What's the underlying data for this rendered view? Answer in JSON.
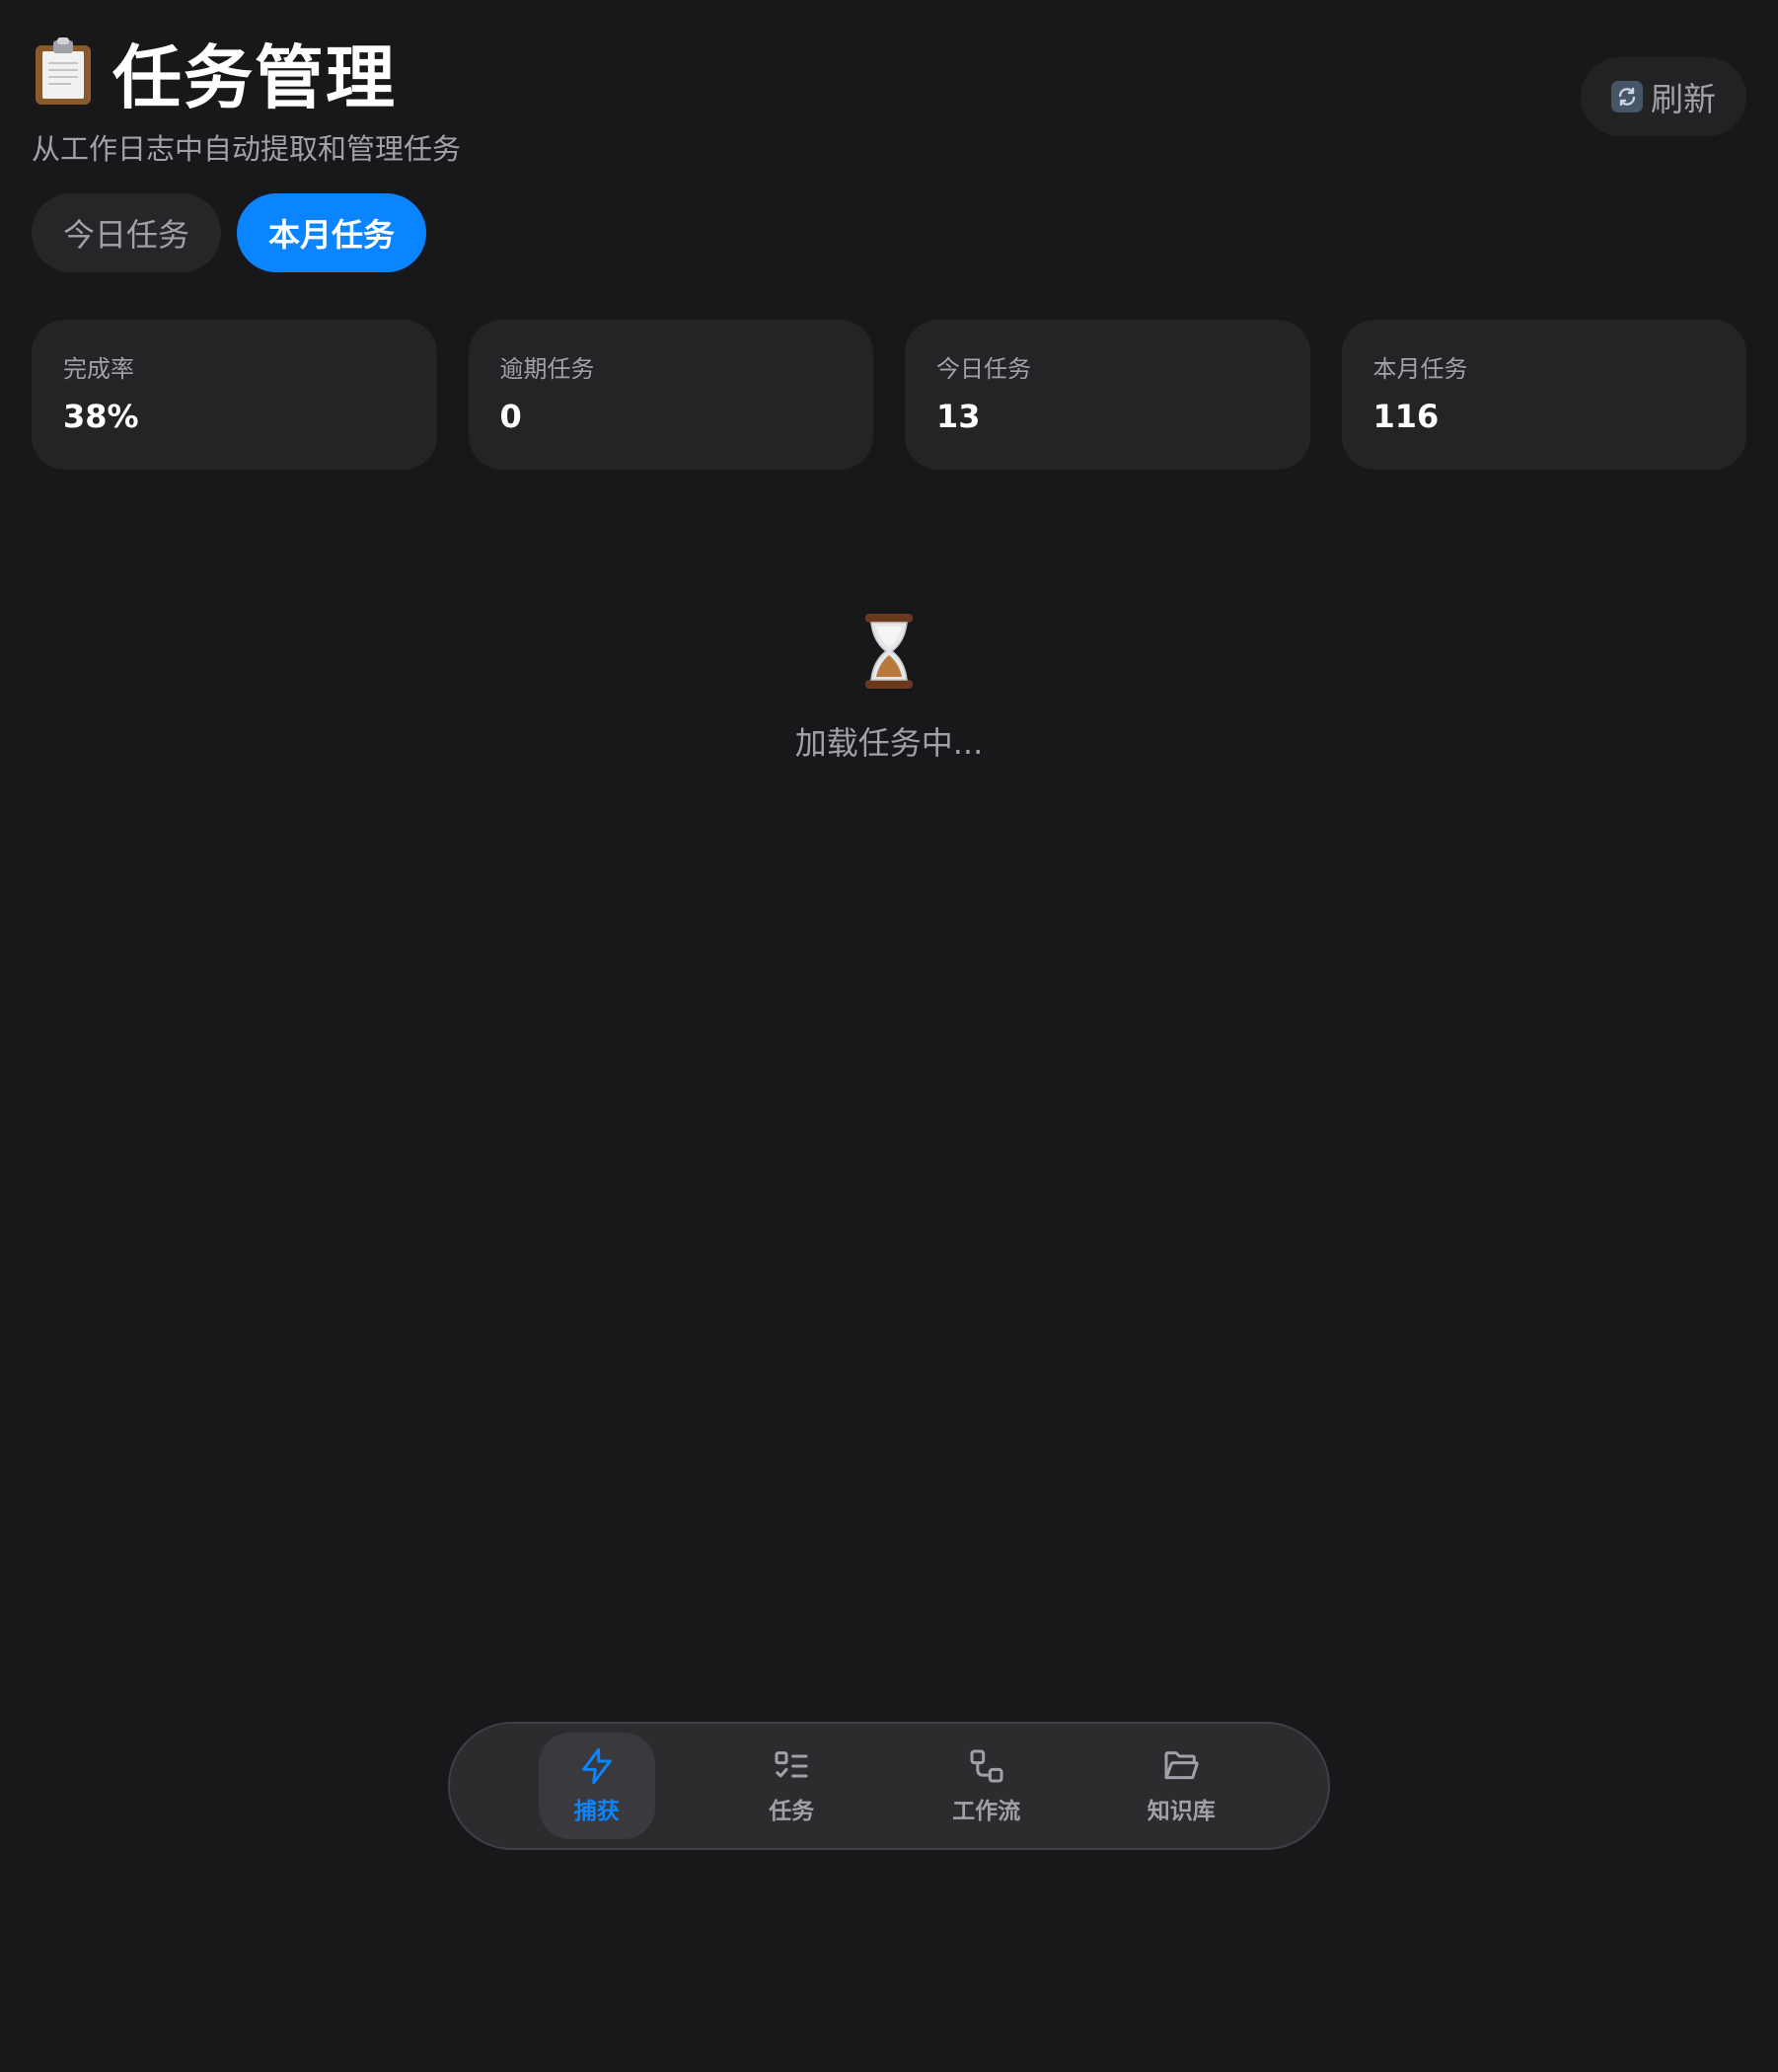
{
  "header": {
    "title": "任务管理",
    "subtitle": "从工作日志中自动提取和管理任务",
    "refresh_label": "刷新"
  },
  "tabs": [
    {
      "label": "今日任务",
      "active": false
    },
    {
      "label": "本月任务",
      "active": true
    }
  ],
  "stats": [
    {
      "label": "完成率",
      "value": "38%"
    },
    {
      "label": "逾期任务",
      "value": "0"
    },
    {
      "label": "今日任务",
      "value": "13"
    },
    {
      "label": "本月任务",
      "value": "116"
    }
  ],
  "loading": {
    "text": "加载任务中..."
  },
  "bottom_nav": [
    {
      "label": "捕获",
      "icon": "lightning-icon",
      "active": true
    },
    {
      "label": "任务",
      "icon": "checklist-icon",
      "active": false
    },
    {
      "label": "工作流",
      "icon": "workflow-icon",
      "active": false
    },
    {
      "label": "知识库",
      "icon": "folder-open-icon",
      "active": false
    }
  ],
  "colors": {
    "background": "#18181b",
    "accent": "#0a84ff",
    "card": "#242427",
    "muted_text": "#a1a1aa"
  }
}
